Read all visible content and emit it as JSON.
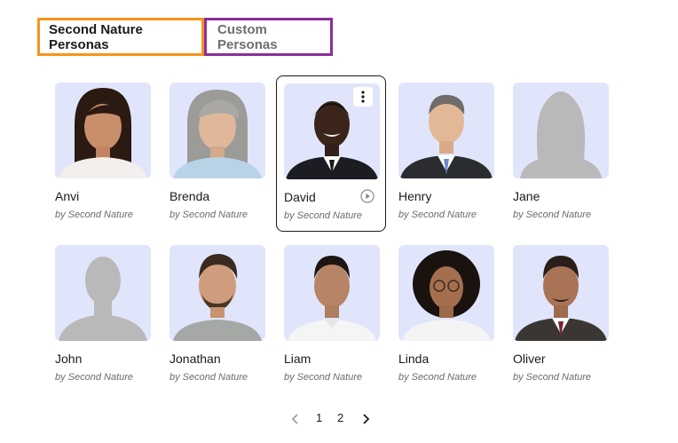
{
  "tabs": [
    {
      "label": "Second Nature Personas",
      "active": true
    },
    {
      "label": "Custom Personas",
      "active": false
    }
  ],
  "personas": [
    {
      "name": "Anvi",
      "by": "by Second Nature",
      "avatar": "female-photo"
    },
    {
      "name": "Brenda",
      "by": "by Second Nature",
      "avatar": "female-photo"
    },
    {
      "name": "David",
      "by": "by Second Nature",
      "avatar": "male-photo",
      "selected": true
    },
    {
      "name": "Henry",
      "by": "by Second Nature",
      "avatar": "male-photo"
    },
    {
      "name": "Jane",
      "by": "by Second Nature",
      "avatar": "placeholder-female"
    },
    {
      "name": "John",
      "by": "by Second Nature",
      "avatar": "placeholder-male"
    },
    {
      "name": "Jonathan",
      "by": "by Second Nature",
      "avatar": "male-photo"
    },
    {
      "name": "Liam",
      "by": "by Second Nature",
      "avatar": "male-photo"
    },
    {
      "name": "Linda",
      "by": "by Second Nature",
      "avatar": "female-photo"
    },
    {
      "name": "Oliver",
      "by": "by Second Nature",
      "avatar": "male-photo"
    }
  ],
  "pagination": {
    "prev_icon": "chevron-left-icon",
    "pages": [
      "1",
      "2"
    ],
    "next_icon": "chevron-right-icon"
  },
  "colors": {
    "active_tab_border": "#f7941d",
    "inactive_tab_border": "#8e2d9a",
    "avatar_background": "#e1e5fb",
    "placeholder_silhouette": "#b9b9b9"
  }
}
